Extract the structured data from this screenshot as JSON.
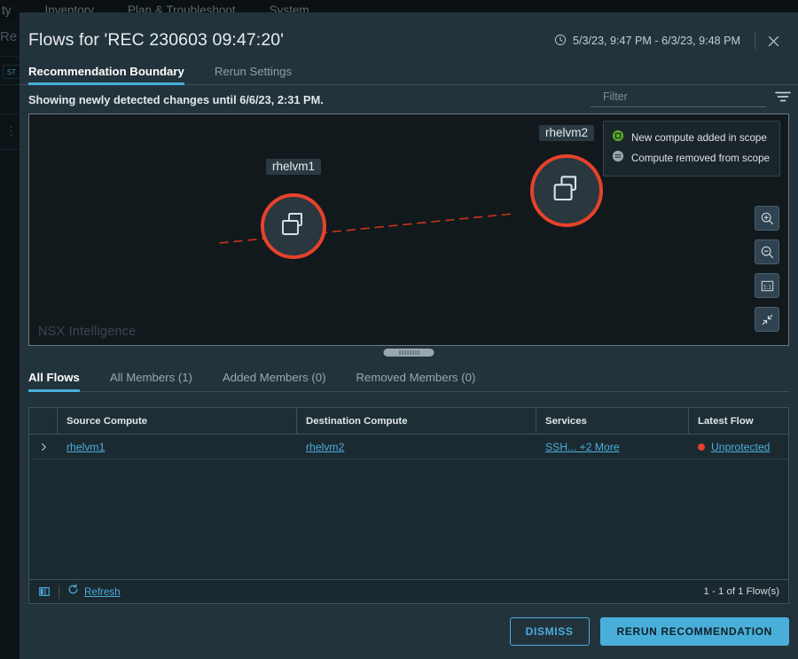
{
  "background": {
    "nav_items": [
      "ty",
      "Inventory",
      "Plan & Troubleshoot",
      "System"
    ],
    "ghost_title": "Re",
    "chip_label": "ST"
  },
  "modal": {
    "title": "Flows for 'REC 230603 09:47:20'",
    "date_range": "5/3/23, 9:47 PM - 6/3/23, 9:48 PM",
    "clock_icon": "clock-icon",
    "close_icon": "close-icon",
    "tabs": [
      {
        "label": "Recommendation Boundary",
        "active": true
      },
      {
        "label": "Rerun Settings",
        "active": false
      }
    ],
    "subtitle": "Showing newly detected changes until 6/6/23, 2:31 PM.",
    "filter": {
      "placeholder": "Filter",
      "value": "",
      "icon": "filter-icon"
    }
  },
  "graph": {
    "watermark": "NSX Intelligence",
    "legend": [
      {
        "label": "New compute added in scope",
        "icon": "compute-added-icon",
        "color": "#5aa82e"
      },
      {
        "label": "Compute removed from scope",
        "icon": "compute-removed-icon",
        "color": "#9aa7ad"
      }
    ],
    "nodes": [
      {
        "label": "rhelvm1",
        "icon": "vm-icon",
        "ring_color": "#e8422b"
      },
      {
        "label": "rhelvm2",
        "icon": "vm-icon",
        "ring_color": "#e8422b"
      }
    ],
    "edge": {
      "style": "dashed",
      "color": "#c8341c"
    },
    "controls": [
      {
        "name": "zoom-in-icon",
        "label": ""
      },
      {
        "name": "zoom-out-icon",
        "label": ""
      },
      {
        "name": "actual-size-icon",
        "label": "1:1"
      },
      {
        "name": "fit-to-screen-icon",
        "label": ""
      }
    ]
  },
  "bottom_tabs": [
    {
      "label": "All Flows",
      "active": true
    },
    {
      "label": "All Members (1)",
      "active": false
    },
    {
      "label": "Added Members (0)",
      "active": false
    },
    {
      "label": "Removed Members (0)",
      "active": false
    }
  ],
  "table": {
    "columns": [
      "Source Compute",
      "Destination Compute",
      "Services",
      "Latest Flow"
    ],
    "rows": [
      {
        "expand_icon": "chevron-right-icon",
        "source": "rhelvm1",
        "destination": "rhelvm2",
        "services": "SSH... +2 More",
        "latest_flow": "Unprotected",
        "latest_flow_color": "#e8422b"
      }
    ],
    "footer": {
      "column_toggle_icon": "column-settings-icon",
      "refresh_icon": "refresh-icon",
      "refresh_label": "Refresh",
      "count": "1 - 1 of 1 Flow(s)"
    }
  },
  "footer_buttons": {
    "dismiss_label": "DISMISS",
    "rerun_label": "RERUN RECOMMENDATION",
    "accent": "#49afd9"
  }
}
